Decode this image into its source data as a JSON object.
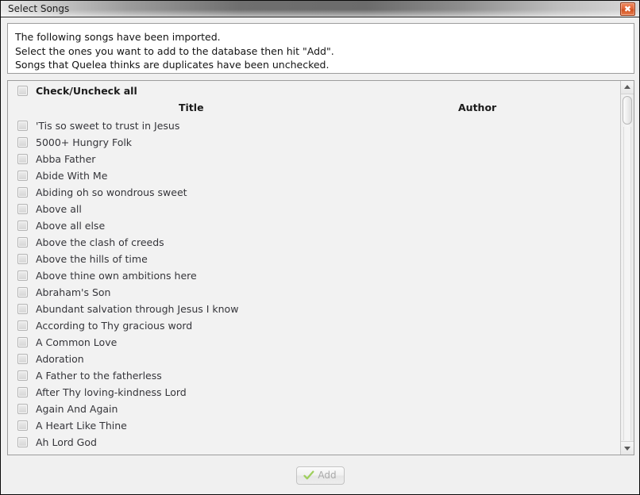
{
  "window": {
    "title": "Select Songs",
    "close_label": "✖",
    "close_icon": "close-icon",
    "accent_close": "#d1511f"
  },
  "intro": {
    "lines": [
      "The following songs have been imported.",
      "Select the ones you want to add to the database then hit \"Add\".",
      "Songs that Quelea thinks are duplicates have been unchecked."
    ]
  },
  "list": {
    "check_all_label": "Check/Uncheck all",
    "columns": {
      "title": "Title",
      "author": "Author"
    },
    "rows": [
      {
        "title": "'Tis so sweet to trust in Jesus",
        "author": "",
        "checked": false
      },
      {
        "title": "5000+ Hungry Folk",
        "author": "",
        "checked": false
      },
      {
        "title": "Abba Father",
        "author": "",
        "checked": false
      },
      {
        "title": "Abide With Me",
        "author": "",
        "checked": false
      },
      {
        "title": "Abiding oh so wondrous sweet",
        "author": "",
        "checked": false
      },
      {
        "title": "Above all",
        "author": "",
        "checked": false
      },
      {
        "title": "Above all else",
        "author": "",
        "checked": false
      },
      {
        "title": "Above the clash of creeds",
        "author": "",
        "checked": false
      },
      {
        "title": "Above the hills of time",
        "author": "",
        "checked": false
      },
      {
        "title": "Above thine own ambitions here",
        "author": "",
        "checked": false
      },
      {
        "title": "Abraham's Son",
        "author": "",
        "checked": false
      },
      {
        "title": "Abundant salvation through Jesus I know",
        "author": "",
        "checked": false
      },
      {
        "title": "According to Thy gracious word",
        "author": "",
        "checked": false
      },
      {
        "title": "A Common Love",
        "author": "",
        "checked": false
      },
      {
        "title": "Adoration",
        "author": "",
        "checked": false
      },
      {
        "title": "A Father to the fatherless",
        "author": "",
        "checked": false
      },
      {
        "title": "After Thy loving-kindness Lord",
        "author": "",
        "checked": false
      },
      {
        "title": "Again And Again",
        "author": "",
        "checked": false
      },
      {
        "title": "A Heart Like Thine",
        "author": "",
        "checked": false
      },
      {
        "title": "Ah Lord God",
        "author": "",
        "checked": false
      }
    ]
  },
  "scrollbar": {
    "up_icon": "chevron-up-icon",
    "down_icon": "chevron-down-icon"
  },
  "footer": {
    "add_label": "Add",
    "add_icon": "checkmark-icon",
    "add_enabled": false
  }
}
